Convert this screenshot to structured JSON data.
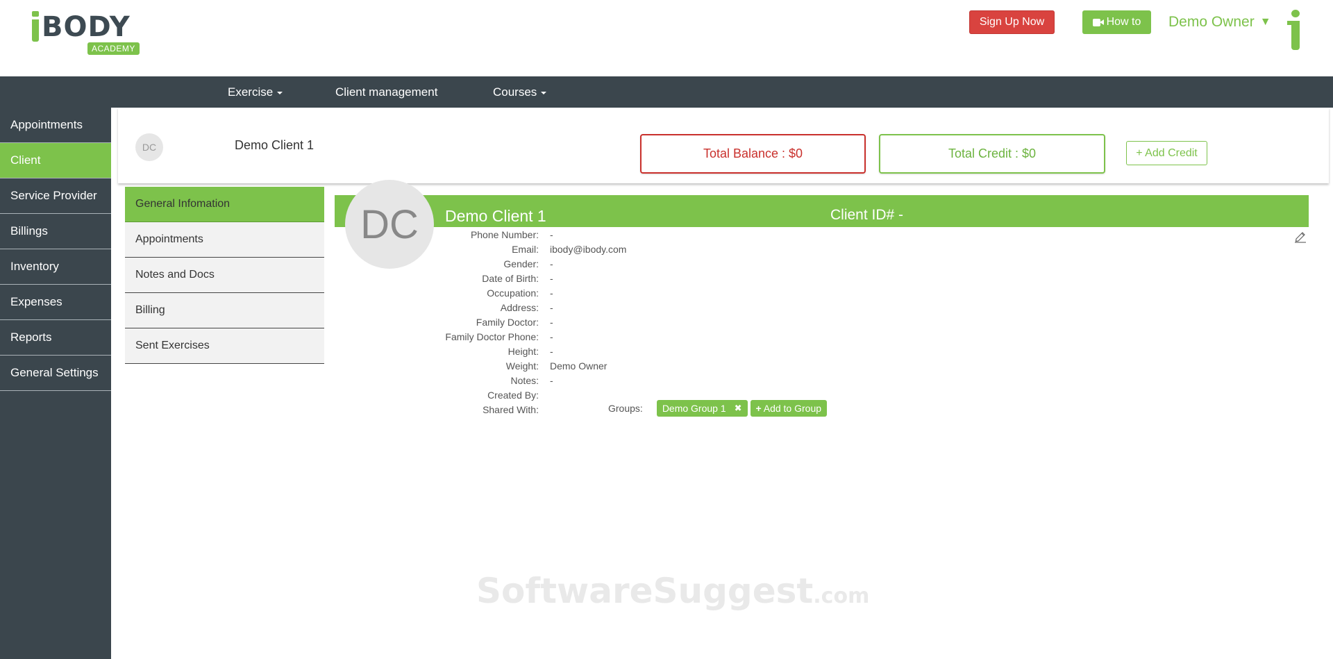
{
  "header": {
    "logo_text": "BODY",
    "logo_badge": "ACADEMY",
    "signup_label": "Sign Up Now",
    "howto_label": "How to",
    "user_name": "Demo Owner",
    "user_caret": "▼"
  },
  "topnav": {
    "items": [
      {
        "label": "Exercise",
        "has_caret": true
      },
      {
        "label": "Client management",
        "has_caret": false
      },
      {
        "label": "Courses",
        "has_caret": true
      }
    ]
  },
  "sidebar": {
    "items": [
      {
        "label": "Appointments"
      },
      {
        "label": "Client",
        "active": true
      },
      {
        "label": "Service Provider"
      },
      {
        "label": "Billings"
      },
      {
        "label": "Inventory"
      },
      {
        "label": "Expenses"
      },
      {
        "label": "Reports"
      },
      {
        "label": "General Settings"
      }
    ]
  },
  "client_strip": {
    "avatar_initials": "DC",
    "name": "Demo Client 1",
    "total_balance": "Total Balance : $0",
    "total_credit": "Total Credit : $0",
    "add_credit_label": "+ Add Credit"
  },
  "submenu": {
    "items": [
      {
        "label": "General Infomation",
        "active": true
      },
      {
        "label": "Appointments"
      },
      {
        "label": "Notes and Docs"
      },
      {
        "label": "Billing"
      },
      {
        "label": "Sent Exercises"
      }
    ]
  },
  "detail": {
    "avatar_initials": "DC",
    "name": "Demo Client 1",
    "client_id": "Client ID# -",
    "fields": [
      {
        "label": "Phone Number:",
        "value": "-"
      },
      {
        "label": "Email:",
        "value": "ibody@ibody.com"
      },
      {
        "label": "Gender:",
        "value": "-"
      },
      {
        "label": "Date of Birth:",
        "value": "-"
      },
      {
        "label": "Occupation:",
        "value": "-"
      },
      {
        "label": "Address:",
        "value": "-"
      },
      {
        "label": "Family Doctor:",
        "value": "-"
      },
      {
        "label": "Family Doctor Phone:",
        "value": "-"
      },
      {
        "label": "Height:",
        "value": "-"
      },
      {
        "label": "Weight:",
        "value": "Demo Owner"
      },
      {
        "label": "Notes:",
        "value": "-"
      },
      {
        "label": "Created By:",
        "value": ""
      },
      {
        "label": "Shared With:",
        "value": ""
      }
    ],
    "groups_label": "Groups:",
    "group_tags": [
      "Demo Group 1"
    ],
    "add_group_label": "Add to Group"
  },
  "watermark": {
    "main": "SoftwareSuggest",
    "suffix": ".com"
  },
  "colors": {
    "accent": "#7dc24b",
    "dark": "#3b464d",
    "danger": "#d9433f"
  }
}
